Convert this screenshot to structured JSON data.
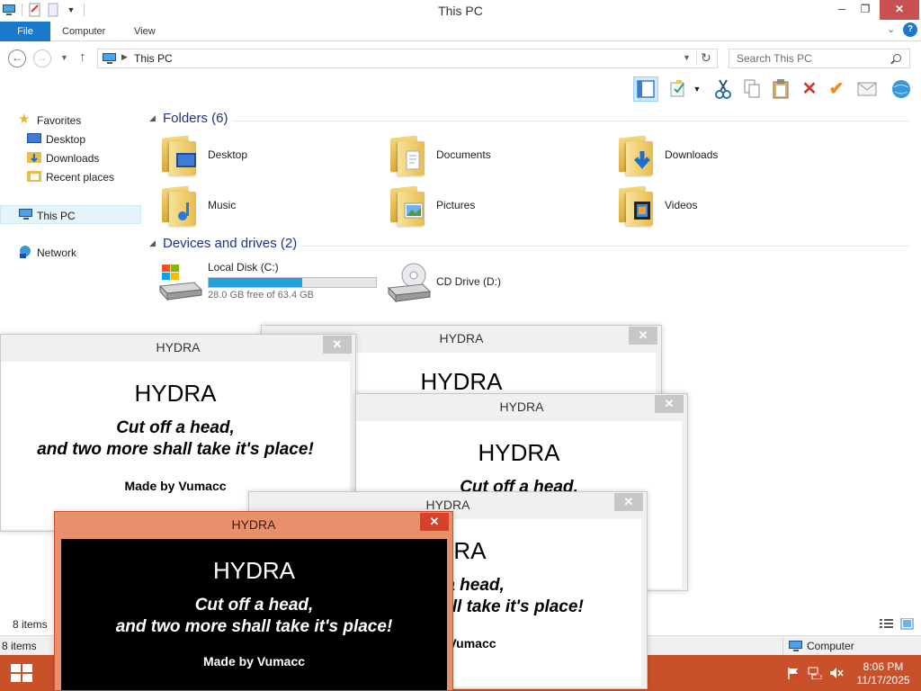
{
  "window": {
    "title": "This PC",
    "minimize": "─",
    "maximize": "❐",
    "close": "✕"
  },
  "ribbon": {
    "tabs": [
      "File",
      "Computer",
      "View"
    ],
    "chevron": "⌄",
    "help": "?"
  },
  "address": {
    "back": "←",
    "forward": "→",
    "up": "↑",
    "crumb": "This PC",
    "refresh": "↻",
    "search_placeholder": "Search This PC"
  },
  "nav": {
    "favorites": "Favorites",
    "desktop": "Desktop",
    "downloads": "Downloads",
    "recent": "Recent places",
    "thispc": "This PC",
    "network": "Network"
  },
  "folders": {
    "header": "Folders (6)",
    "items": [
      "Desktop",
      "Documents",
      "Downloads",
      "Music",
      "Pictures",
      "Videos"
    ]
  },
  "devices": {
    "header": "Devices and drives (2)",
    "local": {
      "name": "Local Disk (C:)",
      "free_text": "28.0 GB free of 63.4 GB",
      "used_fraction": 0.56
    },
    "cd": {
      "name": "CD Drive (D:)"
    }
  },
  "status": {
    "items_count": "8 items",
    "items_count_bottom": "8 items",
    "location": "Computer"
  },
  "taskbar": {
    "time": "8:06 PM",
    "date": "11/17/2025"
  },
  "dialog": {
    "title": "HYDRA",
    "heading": "HYDRA",
    "line1": "Cut off a head,",
    "line2": "and two more shall take it's place!",
    "credit": "Made by Vumacc",
    "close": "✕"
  },
  "colors": {
    "accent": "#1979ca",
    "taskbar": "#c8512a",
    "active_dialog_frame": "#e8906b",
    "drive_fill": "#26a0da"
  }
}
